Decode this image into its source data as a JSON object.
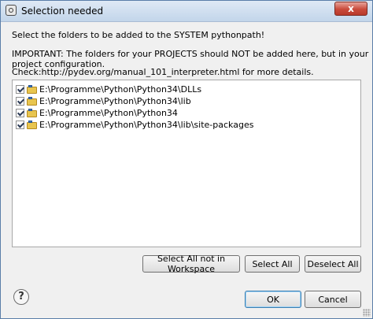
{
  "window": {
    "title": "Selection needed",
    "close_label": "x"
  },
  "message": {
    "line1": "Select the folders to be added to the SYSTEM pythonpath!",
    "line2": "IMPORTANT: The folders for your PROJECTS should NOT be added here, but in your project configuration.",
    "line3": "Check:http://pydev.org/manual_101_interpreter.html for more details."
  },
  "folders": [
    {
      "path": "E:\\Programme\\Python\\Python34\\DLLs",
      "checked": true
    },
    {
      "path": "E:\\Programme\\Python\\Python34\\lib",
      "checked": true
    },
    {
      "path": "E:\\Programme\\Python\\Python34",
      "checked": true
    },
    {
      "path": "E:\\Programme\\Python\\Python34\\lib\\site-packages",
      "checked": true
    }
  ],
  "buttons": {
    "select_all_not_workspace": "Select All not in Workspace",
    "select_all": "Select All",
    "deselect_all": "Deselect All",
    "ok": "OK",
    "cancel": "Cancel",
    "help": "?"
  },
  "colors": {
    "close_button": "#c94a3b",
    "folder": "#e8c54f"
  }
}
